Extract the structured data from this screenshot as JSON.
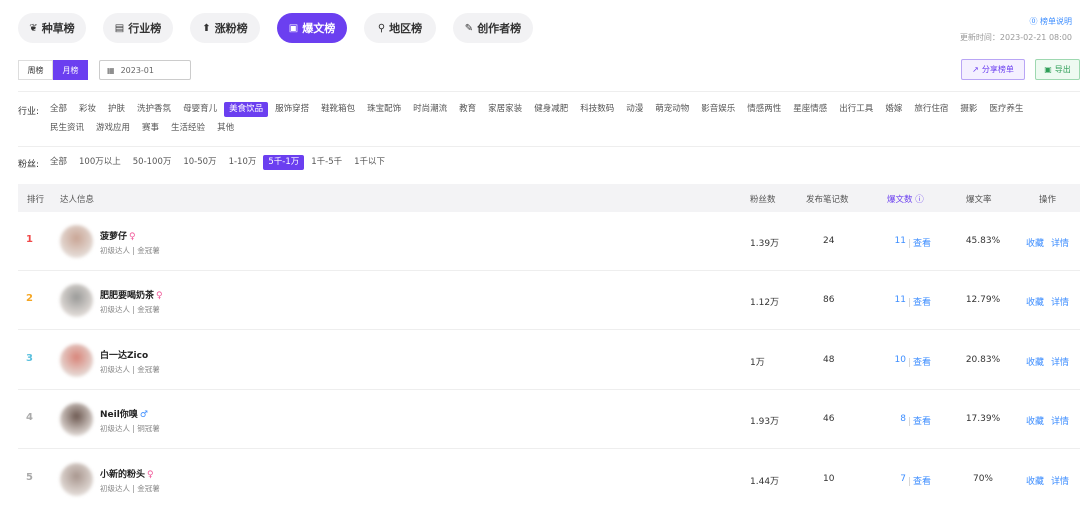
{
  "tabs": [
    {
      "label": "种草榜",
      "icon": "sprout-icon",
      "glyph": "❦",
      "active": false,
      "width": 68
    },
    {
      "label": "行业榜",
      "icon": "briefcase-icon",
      "glyph": "▤",
      "active": false,
      "width": 70
    },
    {
      "label": "涨粉榜",
      "icon": "arrow-up-circle-icon",
      "glyph": "⬆",
      "active": false,
      "width": 70
    },
    {
      "label": "爆文榜",
      "icon": "document-icon",
      "glyph": "▣",
      "active": true,
      "width": 70
    },
    {
      "label": "地区榜",
      "icon": "location-pin-icon",
      "glyph": "⚲",
      "active": false,
      "width": 72
    },
    {
      "label": "创作者榜",
      "icon": "pen-icon",
      "glyph": "✎",
      "active": false,
      "width": 80
    }
  ],
  "header": {
    "help_link": "⓪ 榜单说明",
    "update_time": "更新时间：2023-02-21 08:00"
  },
  "period": {
    "week": "周榜",
    "month": "月榜"
  },
  "date_value": "2023-01",
  "share_label": "分享榜单",
  "export_label": "导出",
  "industry": {
    "label": "行业:",
    "options": [
      "全部",
      "彩妆",
      "护肤",
      "洗护香氛",
      "母婴育儿",
      "美食饮品",
      "服饰穿搭",
      "鞋靴箱包",
      "珠宝配饰",
      "时尚潮流",
      "教育",
      "家居家装",
      "健身减肥",
      "科技数码",
      "动漫",
      "萌宠动物",
      "影音娱乐",
      "情感两性",
      "星座情感",
      "出行工具",
      "婚嫁",
      "旅行住宿",
      "摄影",
      "医疗养生",
      "民生资讯",
      "游戏应用",
      "赛事",
      "生活经验",
      "其他"
    ],
    "selected": "美食饮品"
  },
  "fans": {
    "label": "粉丝:",
    "options": [
      "全部",
      "100万以上",
      "50-100万",
      "10-50万",
      "1-10万",
      "5千-1万",
      "1千-5千",
      "1千以下"
    ],
    "selected": "5千-1万"
  },
  "table": {
    "headers": {
      "rank": "排行",
      "info": "达人信息",
      "fans": "粉丝数",
      "notes": "发布笔记数",
      "viral": "爆文数 ⓘ",
      "rate": "爆文率",
      "ops": "操作"
    },
    "view_label": "查看",
    "collect_label": "收藏",
    "detail_label": "详情",
    "rows": [
      {
        "rank": "1",
        "rank_color": "#f04848",
        "name": "菠萝仔",
        "gender": "♀",
        "gender_color": "#f05a9a",
        "sub": "初级达人 | 金冠薯",
        "fans": "1.39万",
        "notes": "24",
        "viral": "11",
        "rate": "45.83%",
        "avatar_color": "#c9a595"
      },
      {
        "rank": "2",
        "rank_color": "#f5a623",
        "name": "肥肥要喝奶茶",
        "gender": "♀",
        "gender_color": "#f05a9a",
        "sub": "初级达人 | 金冠薯",
        "fans": "1.12万",
        "notes": "86",
        "viral": "11",
        "rate": "12.79%",
        "avatar_color": "#9a9a98"
      },
      {
        "rank": "3",
        "rank_color": "#5bc0de",
        "name": "白一达Zico",
        "gender": "",
        "gender_color": "#f05a9a",
        "sub": "初级达人 | 金冠薯",
        "fans": "1万",
        "notes": "48",
        "viral": "10",
        "rate": "20.83%",
        "avatar_color": "#d8857a"
      },
      {
        "rank": "4",
        "rank_color": "#aaaaaa",
        "name": "Neil你嗅",
        "gender": "♂",
        "gender_color": "#3c8dff",
        "sub": "初级达人 | 铜冠薯",
        "fans": "1.93万",
        "notes": "46",
        "viral": "8",
        "rate": "17.39%",
        "avatar_color": "#6e5a52"
      },
      {
        "rank": "5",
        "rank_color": "#aaaaaa",
        "name": "小新的粉头",
        "gender": "♀",
        "gender_color": "#f05a9a",
        "sub": "初级达人 | 金冠薯",
        "fans": "1.44万",
        "notes": "10",
        "viral": "7",
        "rate": "70%",
        "avatar_color": "#a8968e"
      }
    ]
  },
  "colors": {
    "accent": "#6b3ff0",
    "link": "#3c8dff"
  }
}
